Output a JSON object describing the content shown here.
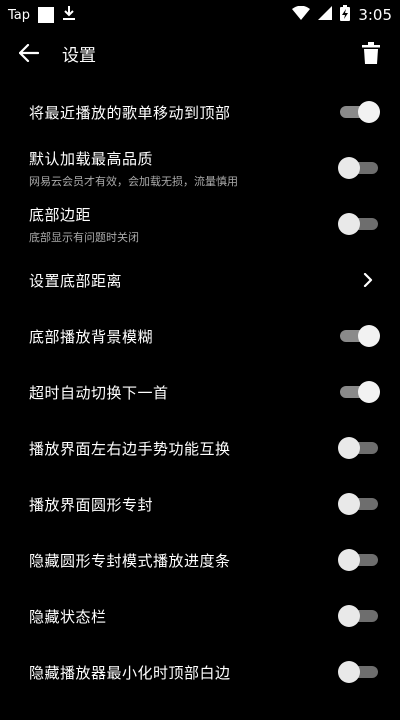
{
  "status": {
    "carrier": "Tap",
    "time": "3:05",
    "icons": [
      "white-square",
      "download-icon",
      "wifi-icon",
      "signal-icon",
      "battery-charging-icon"
    ]
  },
  "header": {
    "title": "设置",
    "back_icon": "arrow-left-icon",
    "delete_icon": "trash-icon"
  },
  "settings": [
    {
      "label": "将最近播放的歌单移动到顶部",
      "desc": "",
      "type": "toggle",
      "on": true
    },
    {
      "label": "默认加载最高品质",
      "desc": "网易云会员才有效，会加载无损，流量慎用",
      "type": "toggle",
      "on": false
    },
    {
      "label": "底部边距",
      "desc": "底部显示有问题时关闭",
      "type": "toggle",
      "on": false
    },
    {
      "label": "设置底部距离",
      "desc": "",
      "type": "link"
    },
    {
      "label": "底部播放背景模糊",
      "desc": "",
      "type": "toggle",
      "on": true
    },
    {
      "label": "超时自动切换下一首",
      "desc": "",
      "type": "toggle",
      "on": true
    },
    {
      "label": "播放界面左右边手势功能互换",
      "desc": "",
      "type": "toggle",
      "on": false
    },
    {
      "label": "播放界面圆形专封",
      "desc": "",
      "type": "toggle",
      "on": false
    },
    {
      "label": "隐藏圆形专封模式播放进度条",
      "desc": "",
      "type": "toggle",
      "on": false
    },
    {
      "label": "隐藏状态栏",
      "desc": "",
      "type": "toggle",
      "on": false
    },
    {
      "label": "隐藏播放器最小化时顶部白边",
      "desc": "",
      "type": "toggle",
      "on": false
    }
  ]
}
